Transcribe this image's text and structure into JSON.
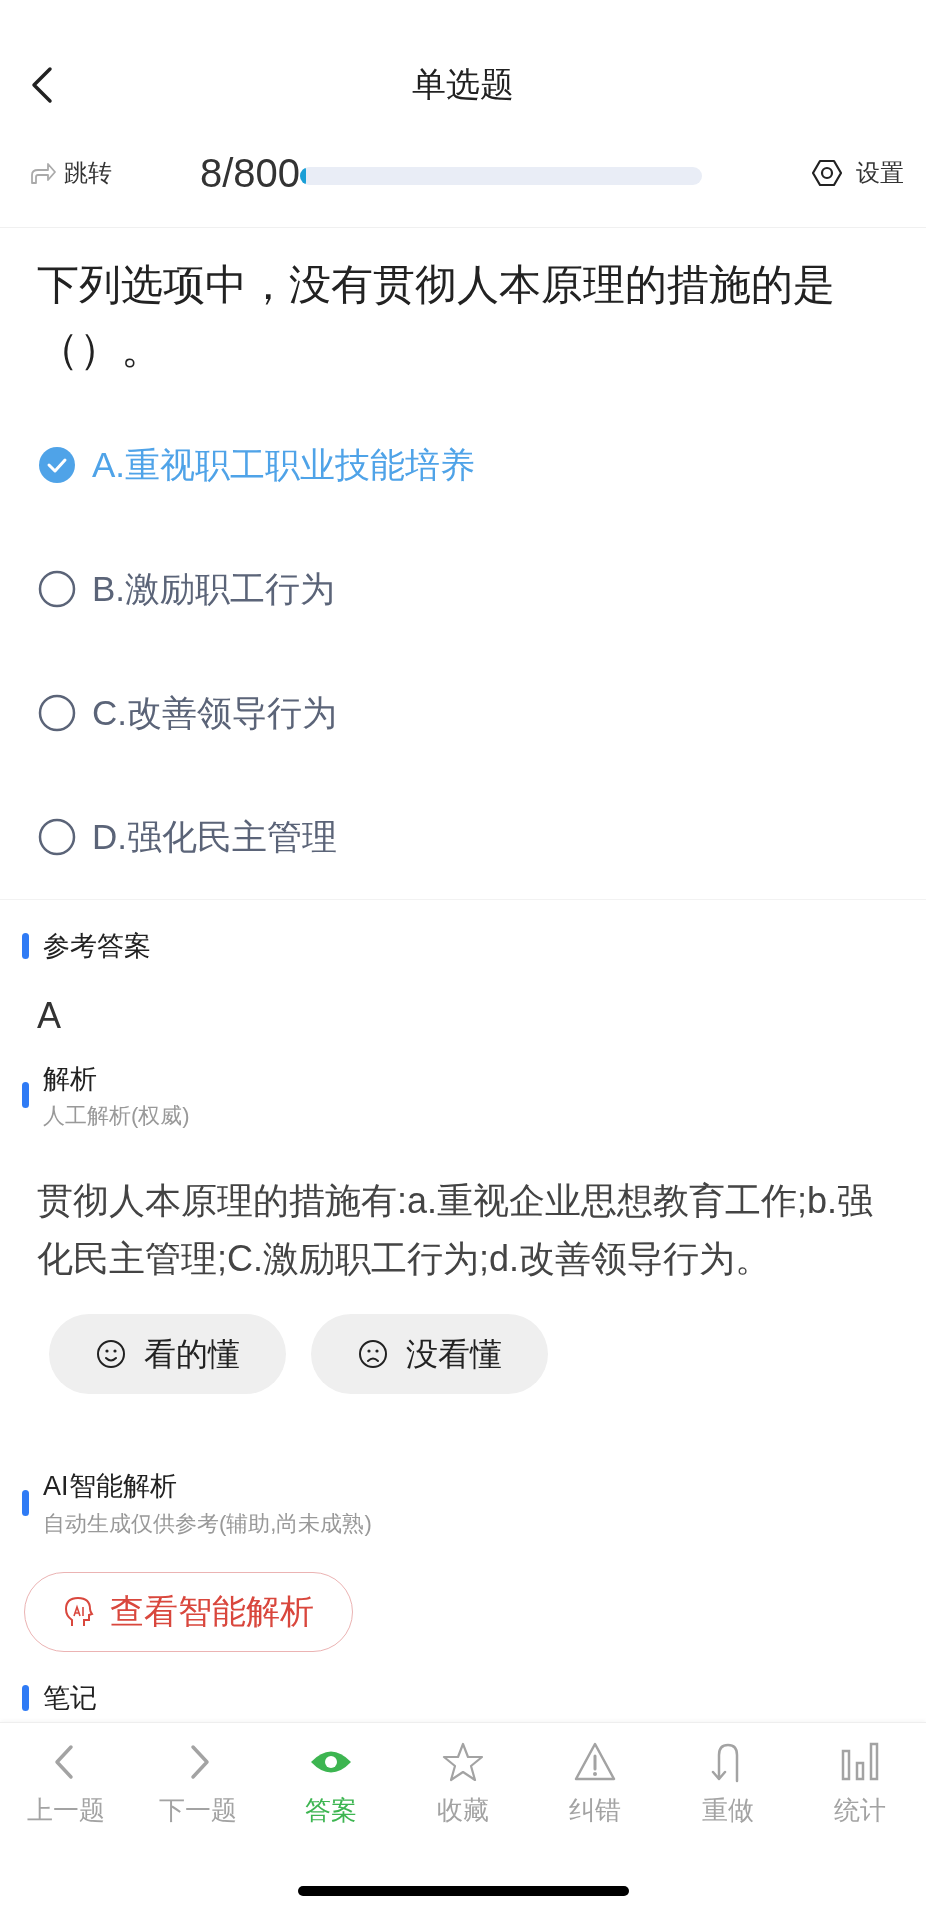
{
  "header": {
    "title": "单选题"
  },
  "toolbar": {
    "jump": "跳转",
    "progress": "8/800",
    "level": 0.01,
    "settings": "设置"
  },
  "question": {
    "text": "下列选项中，没有贯彻人本原理的措施的是（）。",
    "options": [
      {
        "label": "A.重视职工职业技能培养",
        "selected": true
      },
      {
        "label": "B.激励职工行为",
        "selected": false
      },
      {
        "label": "C.改善领导行为",
        "selected": false
      },
      {
        "label": "D.强化民主管理",
        "selected": false
      }
    ]
  },
  "answer": {
    "heading": "参考答案",
    "value": "A"
  },
  "analysis": {
    "heading": "解析",
    "subtitle": "人工解析(权威)",
    "text": "贯彻人本原理的措施有:a.重视企业思想教育工作;b.强化民主管理;C.激励职工行为;d.改善领导行为。",
    "feedback": [
      {
        "label": "看的懂",
        "kind": "smile"
      },
      {
        "label": "没看懂",
        "kind": "frown"
      }
    ]
  },
  "ai": {
    "heading": "AI智能解析",
    "subtitle": "自动生成仅供参考(辅助,尚未成熟)",
    "button": "查看智能解析"
  },
  "notes": {
    "heading": "笔记"
  },
  "nav": [
    {
      "label": "上一题",
      "selected": false
    },
    {
      "label": "下一题",
      "selected": false
    },
    {
      "label": "答案",
      "selected": true
    },
    {
      "label": "收藏",
      "selected": false
    },
    {
      "label": "纠错",
      "selected": false
    },
    {
      "label": "重做",
      "selected": false
    },
    {
      "label": "统计",
      "selected": false
    }
  ]
}
